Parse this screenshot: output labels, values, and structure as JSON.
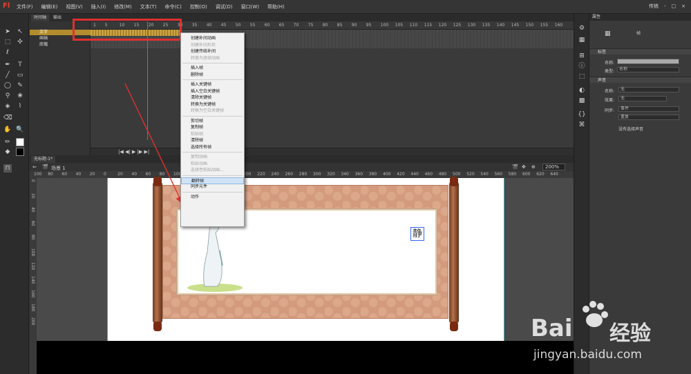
{
  "app": {
    "logo": "Fl"
  },
  "menubar": {
    "items": [
      "文件(F)",
      "编辑(E)",
      "视图(V)",
      "插入(I)",
      "修改(M)",
      "文本(T)",
      "命令(C)",
      "控制(O)",
      "调试(D)",
      "窗口(W)",
      "帮助(H)"
    ],
    "workspace": "传统",
    "window_controls": [
      "-",
      "□",
      "×"
    ]
  },
  "timeline": {
    "tabs": [
      "时间轴",
      "输出"
    ],
    "layers": [
      {
        "name": "文字",
        "selected": true
      },
      {
        "name": "画轴",
        "selected": false
      },
      {
        "name": "底幅",
        "selected": false
      }
    ],
    "ruler_ticks": [
      "1",
      "5",
      "10",
      "15",
      "20",
      "25",
      "30",
      "35",
      "40",
      "45",
      "50",
      "55",
      "60",
      "65",
      "70",
      "75",
      "80",
      "85",
      "90",
      "95",
      "100",
      "105",
      "110",
      "115",
      "120",
      "125",
      "130",
      "135",
      "140",
      "145",
      "150",
      "155",
      "160"
    ]
  },
  "document": {
    "tab": "无标题-1*",
    "scene": "场景 1",
    "zoom": "200%",
    "h_ruler": [
      "100",
      "80",
      "60",
      "40",
      "20",
      "0",
      "20",
      "40",
      "60",
      "80",
      "100",
      "120",
      "140",
      "160",
      "180",
      "200",
      "220",
      "240",
      "260",
      "280",
      "300",
      "320",
      "340",
      "360",
      "380",
      "400",
      "420",
      "440",
      "460",
      "480",
      "500",
      "520",
      "540",
      "560",
      "580",
      "600",
      "620",
      "640"
    ],
    "v_ruler": [
      "0",
      "20",
      "40",
      "60",
      "80",
      "100",
      "120",
      "140",
      "160",
      "180",
      "200"
    ]
  },
  "stage": {
    "character": "静"
  },
  "context_menu": {
    "groups": [
      [
        {
          "label": "创建补间动画",
          "enabled": true
        },
        {
          "label": "创建补间形状",
          "enabled": false
        },
        {
          "label": "创建传统补间",
          "enabled": true
        },
        {
          "label": "转换为逐帧动画",
          "enabled": false
        }
      ],
      [
        {
          "label": "插入帧",
          "enabled": true
        },
        {
          "label": "删除帧",
          "enabled": true
        }
      ],
      [
        {
          "label": "插入关键帧",
          "enabled": true
        },
        {
          "label": "插入空白关键帧",
          "enabled": true
        },
        {
          "label": "清除关键帧",
          "enabled": true
        },
        {
          "label": "转换为关键帧",
          "enabled": true
        },
        {
          "label": "转换为空白关键帧",
          "enabled": false
        }
      ],
      [
        {
          "label": "剪切帧",
          "enabled": true
        },
        {
          "label": "复制帧",
          "enabled": true
        },
        {
          "label": "粘贴帧",
          "enabled": false
        },
        {
          "label": "清除帧",
          "enabled": true
        },
        {
          "label": "选择所有帧",
          "enabled": true
        }
      ],
      [
        {
          "label": "复制动画",
          "enabled": false
        },
        {
          "label": "粘贴动画",
          "enabled": false
        },
        {
          "label": "选择性粘贴动画...",
          "enabled": false
        }
      ],
      [
        {
          "label": "翻转帧",
          "enabled": true,
          "highlighted": true
        },
        {
          "label": "同步元件",
          "enabled": true
        }
      ],
      [
        {
          "label": "动作",
          "enabled": true
        }
      ]
    ]
  },
  "properties": {
    "panel_title": "属性",
    "frame_label": "帧",
    "section_label": "标签",
    "name_label": "名称:",
    "type_label": "类型:",
    "type_value": "名称",
    "section_sound": "声音",
    "sound_name_label": "名称:",
    "sound_name_value": "无",
    "effect_label": "效果:",
    "effect_value": "无",
    "sync_label": "同步:",
    "sync_value": "事件",
    "repeat_value": "重复",
    "no_sound": "没有选择声音"
  },
  "watermark": {
    "brand": "Bai",
    "brand2": "经验",
    "url": "jingyan.baidu.com"
  },
  "colors": {
    "annotation_red": "#e03030",
    "selection_gold": "#b28d2d",
    "highlight_blue": "#cfe3f7"
  }
}
